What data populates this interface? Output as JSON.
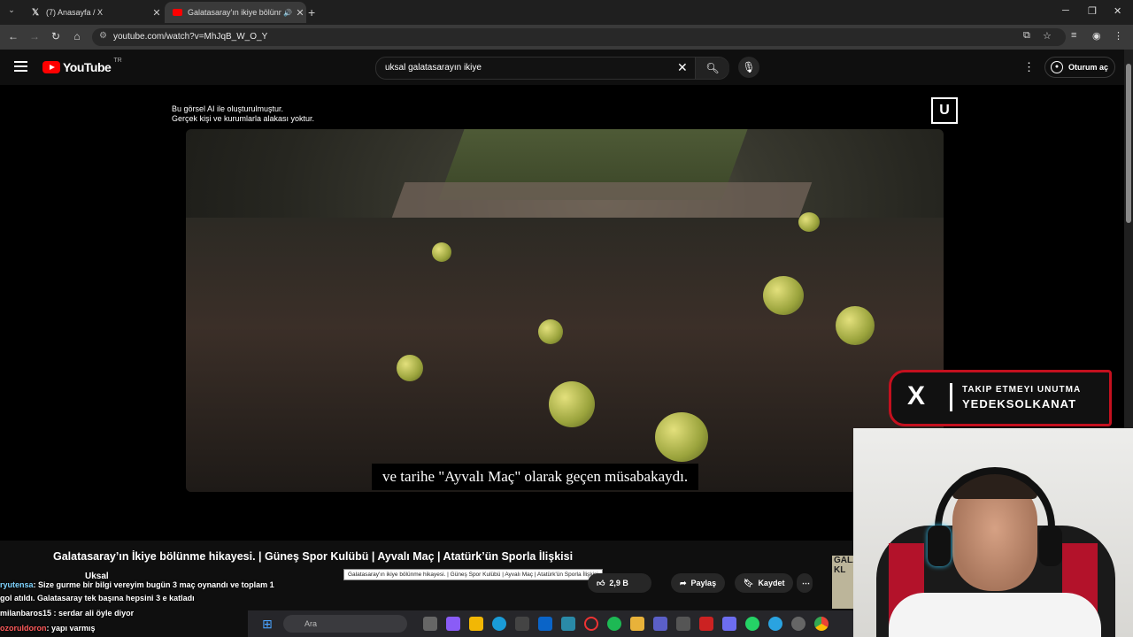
{
  "browser": {
    "tabs": [
      {
        "title": "(7) Anasayfa / X"
      },
      {
        "title": "Galatasaray'ın ikiye bölünme"
      }
    ],
    "url": "youtube.com/watch?v=MhJqB_W_O_Y"
  },
  "youtube": {
    "logo_text": "YouTube",
    "country": "TR",
    "search_query": "uksal galatasarayın ikiye",
    "signin_label": "Oturum aç"
  },
  "video": {
    "ai_notice_line1": "Bu görsel AI ile oluşturulmuştur.",
    "ai_notice_line2": "Gerçek kişi ve kurumlarla alakası yoktur.",
    "channel_logo": "U",
    "subtitle": "ve tarihe \"Ayvalı Maç\" olarak geçen müsabakaydı.",
    "promo_line1": "TAKIP ETMEYI UNUTMA",
    "promo_line2": "YEDEKSOLKANAT",
    "promo_logo": "X",
    "title": "Galatasaray’ın İkiye bölünme hikayesi. | Güneş Spor Kulübü | Ayvalı Maç | Atatürk’ün Sporla İlişkisi",
    "tooltip": "Galatasaray'ın ikiye bölünme hikayesi. | Güneş Spor Kulübü | Ayvalı Maç | Atatürk'ün Sporla İlişkisi",
    "channel": "Uksal",
    "like_count": "2,9 B",
    "share_label": "Paylaş",
    "save_label": "Kaydet",
    "side_thumb_text": "GALA KL"
  },
  "chat": [
    {
      "user": "ryutensa",
      "text": ": Size gurme bir bilgi vereyim bugün 3 maç oynandı ve toplam 1"
    },
    {
      "user": "",
      "text": "gol atıldı. Galatasaray tek başına hepsini 3 e katladı"
    },
    {
      "user": "milanbaros15",
      "text": " : serdar ali öyle diyor"
    },
    {
      "user": "ozoruldoron",
      "text": ": yapı varmış"
    }
  ],
  "taskbar": {
    "search_placeholder": "Ara"
  },
  "colors": {
    "youtube_red": "#ff0000",
    "promo_border": "#c4101e"
  }
}
